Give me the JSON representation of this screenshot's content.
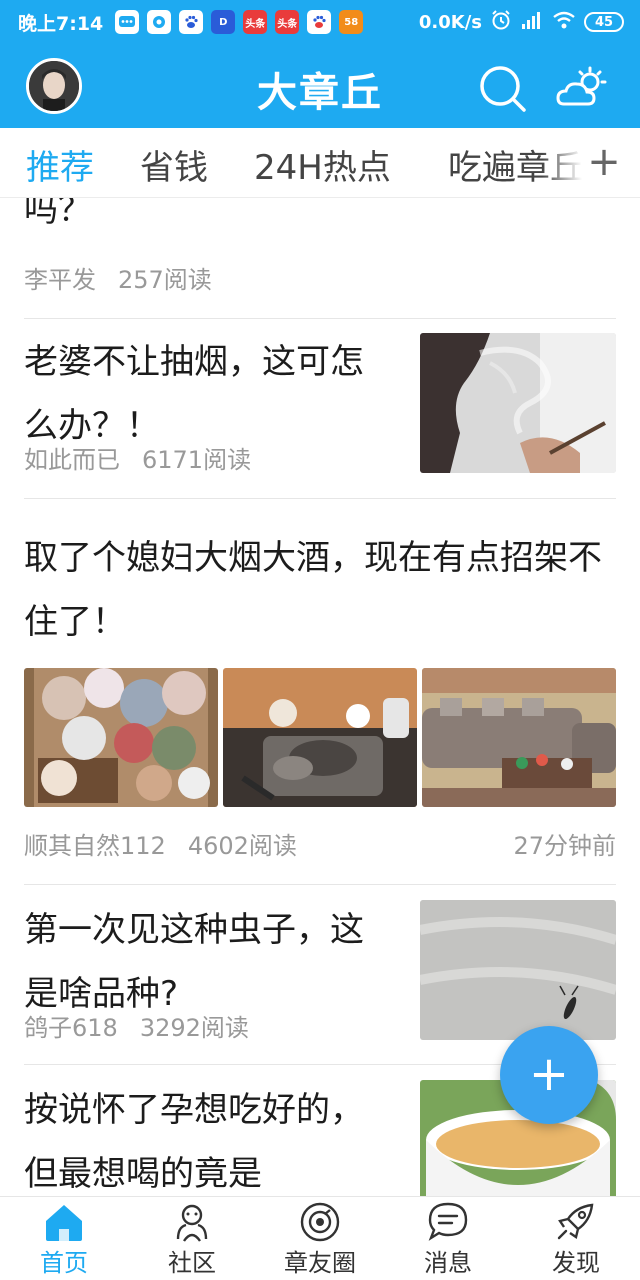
{
  "status_bar": {
    "time": "晚上7:14",
    "network_speed": "0.0K/s",
    "battery": "45",
    "notification_icons": [
      "message-icon",
      "app-icon",
      "baidu-icon",
      "d-app-icon",
      "toutiao-icon",
      "toutiao-icon",
      "baidu-icon",
      "58-icon"
    ],
    "app_labels": [
      "头条",
      "头条",
      "58"
    ]
  },
  "header": {
    "title": "大章丘",
    "accent_color": "#1eaaf1"
  },
  "tabs": [
    {
      "label": "推荐",
      "active": true
    },
    {
      "label": "省钱",
      "active": false
    },
    {
      "label": "24H热点",
      "active": false
    },
    {
      "label": "吃遍章丘",
      "active": false
    }
  ],
  "tab_add_label": "+",
  "feed": [
    {
      "title": "吗？",
      "author": "李平发",
      "reads": "257阅读"
    },
    {
      "title": "老婆不让抽烟，这可怎么办？！",
      "author": "如此而已",
      "reads": "6171阅读"
    },
    {
      "title": "取了个媳妇大烟大酒，现在有点招架不住了！",
      "author": "顺其自然112",
      "reads": "4602阅读",
      "time": "27分钟前"
    },
    {
      "title": "第一次见这种虫子，这是啥品种?",
      "author": "鸽子618",
      "reads": "3292阅读"
    },
    {
      "title": "按说怀了孕想吃好的，但最想喝的竟是"
    }
  ],
  "fab_label": "+",
  "bottom_nav": [
    {
      "label": "首页",
      "icon": "home-icon",
      "active": true
    },
    {
      "label": "社区",
      "icon": "community-icon",
      "active": false
    },
    {
      "label": "章友圈",
      "icon": "friends-circle-icon",
      "active": false
    },
    {
      "label": "消息",
      "icon": "message-icon",
      "active": false
    },
    {
      "label": "发现",
      "icon": "rocket-icon",
      "active": false
    }
  ]
}
